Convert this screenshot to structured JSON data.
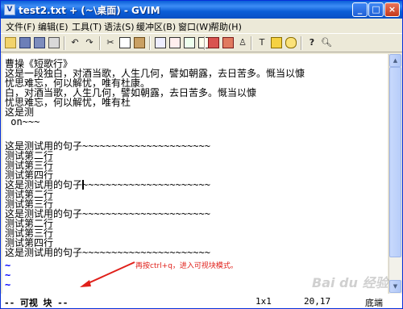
{
  "window": {
    "title": "test2.txt + (~\\桌面) - GVIM",
    "controls": [
      "_",
      "□",
      "×"
    ]
  },
  "menu": [
    "文件(F)",
    "编辑(E)",
    "工具(T)",
    "语法(S)",
    "缓冲区(B)",
    "窗口(W)",
    "帮助(H)"
  ],
  "toolbar": [
    "open-icon",
    "save-icon",
    "save-all-icon",
    "print-icon",
    "undo-icon",
    "redo-icon",
    "cut-icon",
    "copy-icon",
    "paste-icon",
    "find-icon",
    "replace-icon",
    "find-next-icon",
    "find-prev-icon",
    "load-session-icon",
    "save-session-icon",
    "run-script-icon",
    "make-icon",
    "ctags-icon",
    "jump-tag-icon",
    "help-icon",
    "find-help-icon"
  ],
  "editor": {
    "lines": [
      "曹操《短歌行》",
      "这是一段独白，对酒当歌，人生几何，譬如朝露，去日苦多。慨当以慷",
      "忧思难忘，何以解忧，唯有杜康。",
      "白，对酒当歌，人生几何，譬如朝露，去日苦多。慨当以慷",
      "忧思难忘，何以解忧，唯有杜",
      "这是测",
      " on~~~",
      "",
      "这是测试用的句子~~~~~~~~~~~~~~~~~~~~~~",
      "测试第二行",
      "测试第三行",
      "测试第四行",
      "这是测试用的句子~~~~~~~~~~~~~~~~~~~~~~",
      "测试第二行",
      "测试第三行",
      "这是测试用的句子~~~~~~~~~~~~~~~~~~~~~~",
      "测试第二行",
      "测试第三行",
      "测试第四行",
      "这是测试用的句子~~~~~~~~~~~~~~~~~~~~~~"
    ],
    "tildes": [
      "~",
      "~",
      "~"
    ],
    "annotation": "再按ctrl+q，进入可视块模式。"
  },
  "status": {
    "mode": "-- 可视 块 --",
    "selection_size": "1x1",
    "position": "20,17",
    "scroll": "底端"
  },
  "watermark": "Bai du 经验"
}
